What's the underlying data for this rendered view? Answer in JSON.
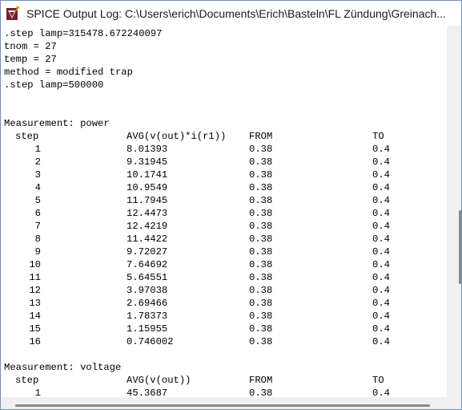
{
  "window": {
    "title": "SPICE Output Log: C:\\Users\\erich\\Documents\\Erich\\Basteln\\FL Zündung\\Greinach..."
  },
  "icons": {
    "app": "ltspice-app-icon"
  },
  "log": {
    "header_lines": [
      ".step lamp=315478.672240097",
      "tnom = 27",
      "temp = 27",
      "method = modified trap",
      ".step lamp=500000",
      "",
      ""
    ],
    "measurement_power": {
      "title": "Measurement: power",
      "columns": [
        "step",
        "AVG(v(out)*i(r1))",
        "FROM",
        "TO"
      ],
      "rows": [
        [
          "1",
          "8.01393",
          "0.38",
          "0.4"
        ],
        [
          "2",
          "9.31945",
          "0.38",
          "0.4"
        ],
        [
          "3",
          "10.1741",
          "0.38",
          "0.4"
        ],
        [
          "4",
          "10.9549",
          "0.38",
          "0.4"
        ],
        [
          "5",
          "11.7945",
          "0.38",
          "0.4"
        ],
        [
          "6",
          "12.4473",
          "0.38",
          "0.4"
        ],
        [
          "7",
          "12.4219",
          "0.38",
          "0.4"
        ],
        [
          "8",
          "11.4422",
          "0.38",
          "0.4"
        ],
        [
          "9",
          "9.72027",
          "0.38",
          "0.4"
        ],
        [
          "10",
          "7.64692",
          "0.38",
          "0.4"
        ],
        [
          "11",
          "5.64551",
          "0.38",
          "0.4"
        ],
        [
          "12",
          "3.97038",
          "0.38",
          "0.4"
        ],
        [
          "13",
          "2.69466",
          "0.38",
          "0.4"
        ],
        [
          "14",
          "1.78373",
          "0.38",
          "0.4"
        ],
        [
          "15",
          "1.15955",
          "0.38",
          "0.4"
        ],
        [
          "16",
          "0.746002",
          "0.38",
          "0.4"
        ]
      ]
    },
    "measurement_voltage": {
      "title": "Measurement: voltage",
      "columns": [
        "step",
        "AVG(v(out))",
        "FROM",
        "TO"
      ],
      "rows": [
        [
          "1",
          "45.3687",
          "0.38",
          "0.4"
        ]
      ]
    }
  }
}
